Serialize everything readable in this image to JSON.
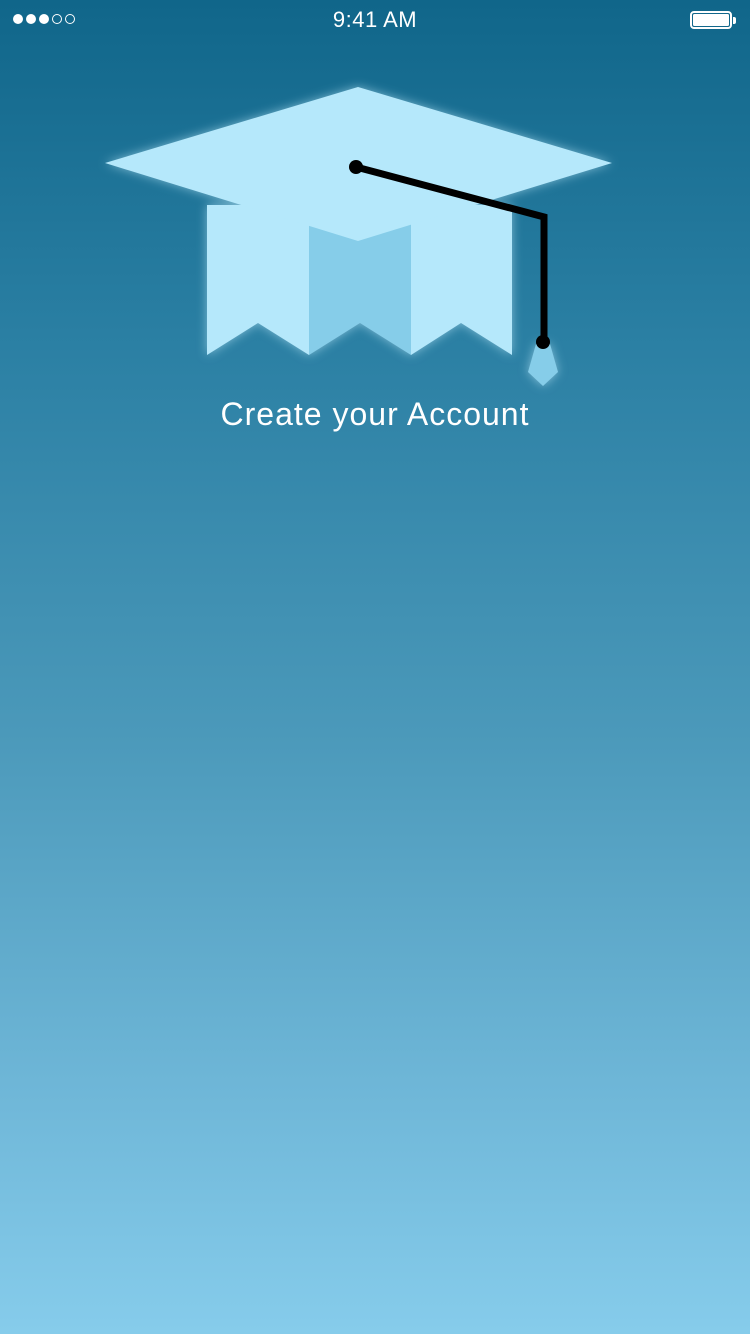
{
  "status_bar": {
    "signal_bars": [
      true,
      true,
      true,
      false,
      false
    ],
    "time": "9:41 AM",
    "battery_level": 1.0
  },
  "logo": {
    "icon": "graduation-cap-icon",
    "colors": {
      "cap_light": "#b5e8fb",
      "cap_mid": "#86cde9",
      "tassel": "#000000"
    }
  },
  "main": {
    "title": "Create your Account"
  },
  "colors": {
    "background_top": "#10668a",
    "background_bottom": "#86cceb",
    "text": "#ffffff"
  }
}
